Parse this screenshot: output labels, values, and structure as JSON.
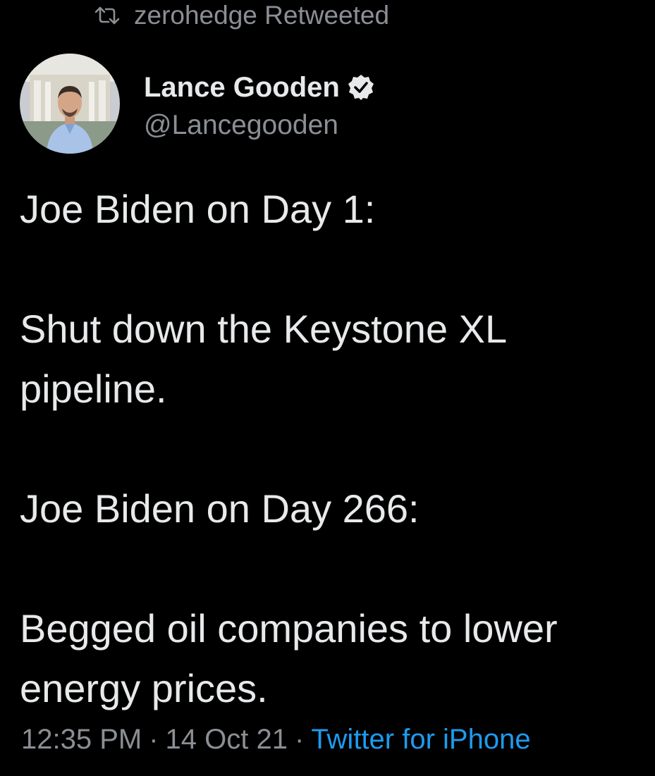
{
  "retweet": {
    "icon": "retweet-icon",
    "text": "zerohedge Retweeted"
  },
  "author": {
    "avatar": "avatar",
    "display_name": "Lance Gooden",
    "verified_icon": "verified-badge-icon",
    "handle": "@Lancegooden"
  },
  "tweet": {
    "paragraphs": [
      "Joe Biden on Day 1:",
      "Shut down the Keystone XL\npipeline.",
      "Joe Biden on Day 266:",
      "Begged oil companies to lower\nenergy prices."
    ]
  },
  "meta": {
    "time": "12:35 PM",
    "separator": "·",
    "date": "14 Oct 21",
    "source": "Twitter for iPhone"
  },
  "colors": {
    "background": "#000000",
    "text": "#e7e9ea",
    "muted": "#8b8f94",
    "link": "#1d9bf0"
  }
}
